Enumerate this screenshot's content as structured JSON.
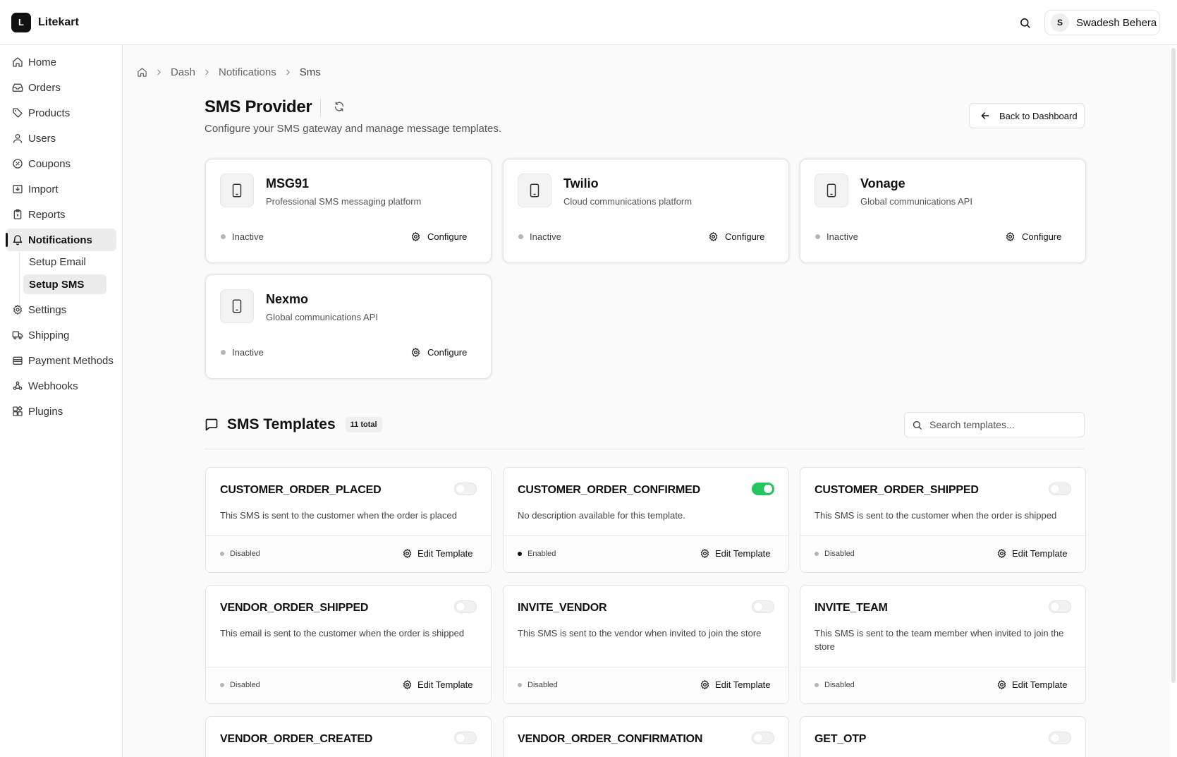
{
  "app": {
    "logo_letter": "L",
    "name": "Litekart"
  },
  "user": {
    "initial": "S",
    "name": "Swadesh Behera"
  },
  "sidebar": {
    "items": [
      {
        "label": "Home",
        "icon": "home-icon"
      },
      {
        "label": "Orders",
        "icon": "inbox-icon"
      },
      {
        "label": "Products",
        "icon": "tag-icon"
      },
      {
        "label": "Users",
        "icon": "user-icon"
      },
      {
        "label": "Coupons",
        "icon": "badge-percent-icon"
      },
      {
        "label": "Import",
        "icon": "import-icon"
      },
      {
        "label": "Reports",
        "icon": "clipboard-icon"
      },
      {
        "label": "Notifications",
        "icon": "bell-icon",
        "active": true
      },
      {
        "label": "Settings",
        "icon": "gear-icon"
      },
      {
        "label": "Shipping",
        "icon": "truck-icon"
      },
      {
        "label": "Payment Methods",
        "icon": "wallet-icon"
      },
      {
        "label": "Webhooks",
        "icon": "webhook-icon"
      },
      {
        "label": "Plugins",
        "icon": "blocks-icon"
      }
    ],
    "sub_items": [
      {
        "label": "Setup Email"
      },
      {
        "label": "Setup SMS",
        "active": true
      }
    ]
  },
  "breadcrumb": {
    "items": [
      "Dash",
      "Notifications",
      "Sms"
    ]
  },
  "header": {
    "title": "SMS Provider",
    "subtitle": "Configure your SMS gateway and manage message templates.",
    "back_label": "Back to Dashboard"
  },
  "providers": [
    {
      "name": "MSG91",
      "description": "Professional SMS messaging platform",
      "status": "Inactive",
      "action": "Configure"
    },
    {
      "name": "Twilio",
      "description": "Cloud communications platform",
      "status": "Inactive",
      "action": "Configure"
    },
    {
      "name": "Vonage",
      "description": "Global communications API",
      "status": "Inactive",
      "action": "Configure"
    },
    {
      "name": "Nexmo",
      "description": "Global communications API",
      "status": "Inactive",
      "action": "Configure"
    }
  ],
  "templates_section": {
    "title": "SMS Templates",
    "count_label": "11 total",
    "search_placeholder": "Search templates..."
  },
  "templates": [
    {
      "name": "CUSTOMER_ORDER_PLACED",
      "description": "This SMS is sent to the customer when the order is placed",
      "enabled": false,
      "status": "Disabled",
      "action": "Edit Template"
    },
    {
      "name": "CUSTOMER_ORDER_CONFIRMED",
      "description": "No description available for this template.",
      "enabled": true,
      "status": "Enabled",
      "action": "Edit Template"
    },
    {
      "name": "CUSTOMER_ORDER_SHIPPED",
      "description": "This SMS is sent to the customer when the order is shipped",
      "enabled": false,
      "status": "Disabled",
      "action": "Edit Template"
    },
    {
      "name": "VENDOR_ORDER_SHIPPED",
      "description": "This email is sent to the customer when the order is shipped",
      "enabled": false,
      "status": "Disabled",
      "action": "Edit Template"
    },
    {
      "name": "INVITE_VENDOR",
      "description": "This SMS is sent to the vendor when invited to join the store",
      "enabled": false,
      "status": "Disabled",
      "action": "Edit Template"
    },
    {
      "name": "INVITE_TEAM",
      "description": "This SMS is sent to the team member when invited to join the store",
      "enabled": false,
      "status": "Disabled",
      "action": "Edit Template"
    },
    {
      "name": "VENDOR_ORDER_CREATED",
      "description": "",
      "enabled": false,
      "status": "",
      "action": ""
    },
    {
      "name": "VENDOR_ORDER_CONFIRMATION",
      "description": "",
      "enabled": false,
      "status": "",
      "action": ""
    },
    {
      "name": "GET_OTP",
      "description": "",
      "enabled": false,
      "status": "",
      "action": ""
    }
  ],
  "colors": {
    "accent": "#111111",
    "toggle_on": "#22c55e",
    "status_dot_off": "#b5b5b5"
  }
}
